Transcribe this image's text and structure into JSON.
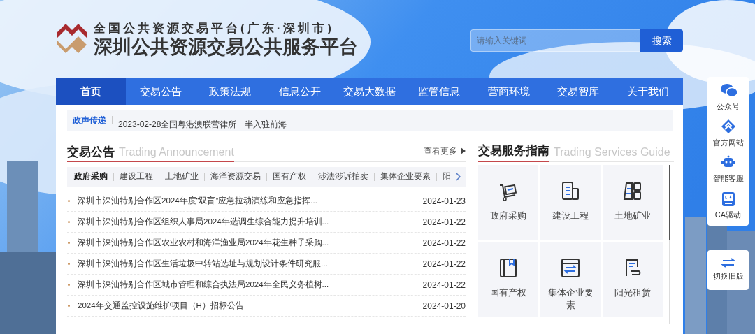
{
  "header": {
    "subtitle": "全国公共资源交易平台(广东·深圳市)",
    "title": "深圳公共资源交易公共服务平台"
  },
  "search": {
    "placeholder": "请输入关键词",
    "button": "搜索"
  },
  "nav": [
    {
      "label": "首页",
      "selected": true
    },
    {
      "label": "交易公告",
      "selected": false
    },
    {
      "label": "政策法规",
      "selected": false
    },
    {
      "label": "信息公开",
      "selected": false
    },
    {
      "label": "交易大数据",
      "selected": false
    },
    {
      "label": "监管信息",
      "selected": false
    },
    {
      "label": "营商环境",
      "selected": false
    },
    {
      "label": "交易智库",
      "selected": false
    },
    {
      "label": "关于我们",
      "selected": false
    }
  ],
  "ticker": {
    "label": "政声传递",
    "text": "2023-02-28全国粤港澳联营律所一半入驻前海"
  },
  "announcements": {
    "title": "交易公告",
    "subtitle": "Trading Announcement",
    "more": "查看更多",
    "tabs": [
      {
        "label": "政府采购",
        "selected": true
      },
      {
        "label": "建设工程",
        "selected": false
      },
      {
        "label": "土地矿业",
        "selected": false
      },
      {
        "label": "海洋资源交易",
        "selected": false
      },
      {
        "label": "国有产权",
        "selected": false
      },
      {
        "label": "涉法涉诉拍卖",
        "selected": false
      },
      {
        "label": "集体企业要素",
        "selected": false
      },
      {
        "label": "阳",
        "selected": false
      }
    ],
    "rows": [
      {
        "title": "深圳市深汕特别合作区2024年度“双盲”应急拉动演练和应急指挥...",
        "date": "2024-01-23"
      },
      {
        "title": "深圳市深汕特别合作区组织人事局2024年选调生综合能力提升培训...",
        "date": "2024-01-22"
      },
      {
        "title": "深圳市深汕特别合作区农业农村和海洋渔业局2024年花生种子采购...",
        "date": "2024-01-22"
      },
      {
        "title": "深圳市深汕特别合作区生活垃圾中转站选址与规划设计条件研究服...",
        "date": "2024-01-22"
      },
      {
        "title": "深圳市深汕特别合作区城市管理和综合执法局2024年全民义务植树...",
        "date": "2024-01-22"
      },
      {
        "title": "2024年交通监控设施维护项目（H）招标公告",
        "date": "2024-01-20"
      }
    ]
  },
  "guide": {
    "title": "交易服务指南",
    "subtitle": "Trading Services Guide",
    "items": [
      {
        "kind": "cart",
        "label": "政府采购"
      },
      {
        "kind": "building",
        "label": "建设工程"
      },
      {
        "kind": "blocks",
        "label": "土地矿业"
      },
      {
        "kind": "book",
        "label": "国有产权"
      },
      {
        "kind": "exchange",
        "label": "集体企业要素"
      },
      {
        "kind": "hand",
        "label": "阳光租赁"
      }
    ]
  },
  "sidebar": {
    "items": [
      {
        "kind": "wechat",
        "label": "公众号"
      },
      {
        "kind": "site",
        "label": "官方网站"
      },
      {
        "kind": "robot",
        "label": "智能客服"
      },
      {
        "kind": "ca",
        "label": "CA驱动"
      }
    ],
    "switch": {
      "label": "切换旧版"
    }
  }
}
